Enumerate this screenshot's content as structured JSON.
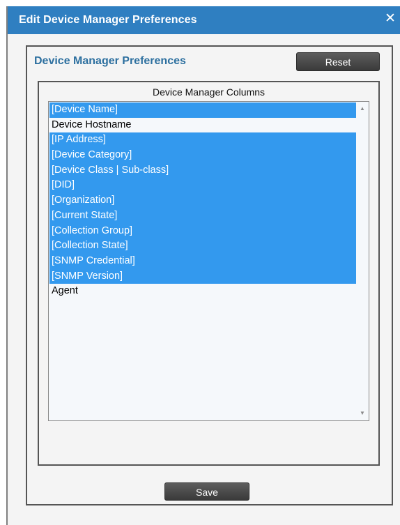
{
  "window": {
    "title": "Edit Device Manager Preferences",
    "close_glyph": "✕"
  },
  "panel": {
    "title": "Device Manager Preferences",
    "reset_label": "Reset",
    "save_label": "Save"
  },
  "columns": {
    "heading": "Device Manager Columns",
    "items": [
      {
        "label": "[Device Name]",
        "selected": true
      },
      {
        "label": "Device Hostname",
        "selected": false
      },
      {
        "label": "[IP Address]",
        "selected": true
      },
      {
        "label": "[Device Category]",
        "selected": true
      },
      {
        "label": "[Device Class | Sub-class]",
        "selected": true
      },
      {
        "label": "[DID]",
        "selected": true
      },
      {
        "label": "[Organization]",
        "selected": true
      },
      {
        "label": "[Current State]",
        "selected": true
      },
      {
        "label": "[Collection Group]",
        "selected": true
      },
      {
        "label": "[Collection State]",
        "selected": true
      },
      {
        "label": "[SNMP Credential]",
        "selected": true
      },
      {
        "label": "[SNMP Version]",
        "selected": true
      },
      {
        "label": "Agent",
        "selected": false
      }
    ]
  },
  "scrollbar": {
    "up_icon": "scroll-up-arrow",
    "down_icon": "scroll-down-arrow"
  },
  "colors": {
    "titlebar": "#2f7fc1",
    "selection": "#3399ee",
    "panel_title": "#2c6f9f"
  }
}
